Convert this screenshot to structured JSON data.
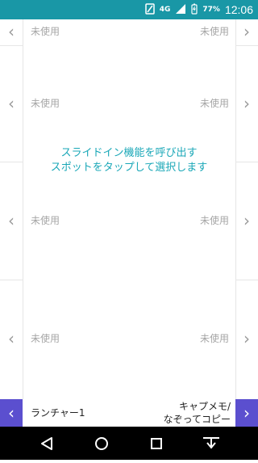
{
  "status_bar": {
    "network": "4G",
    "battery": "77%",
    "time": "12:06",
    "icons": [
      "sim-icon",
      "signal-icon",
      "battery-icon"
    ]
  },
  "rows": [
    {
      "left": "未使用",
      "right": "未使用"
    },
    {
      "left": "未使用",
      "right": "未使用"
    },
    {
      "left": "未使用",
      "right": "未使用"
    },
    {
      "left": "未使用",
      "right": "未使用"
    }
  ],
  "center_message": {
    "line1": "スライドイン機能を呼び出す",
    "line2": "スポットをタップして選択します"
  },
  "bottom_bar": {
    "left_label": "ランチャー1",
    "right_label_line1": "キャプメモ/",
    "right_label_line2": "なぞってコピー"
  },
  "colors": {
    "status_bar": "#1997a6",
    "accent_text": "#19a7b7",
    "nav_button": "#5b4fcf",
    "unused_text": "#a6a6a6"
  },
  "system_nav": [
    "back-icon",
    "home-icon",
    "recents-icon",
    "notifications-icon"
  ]
}
